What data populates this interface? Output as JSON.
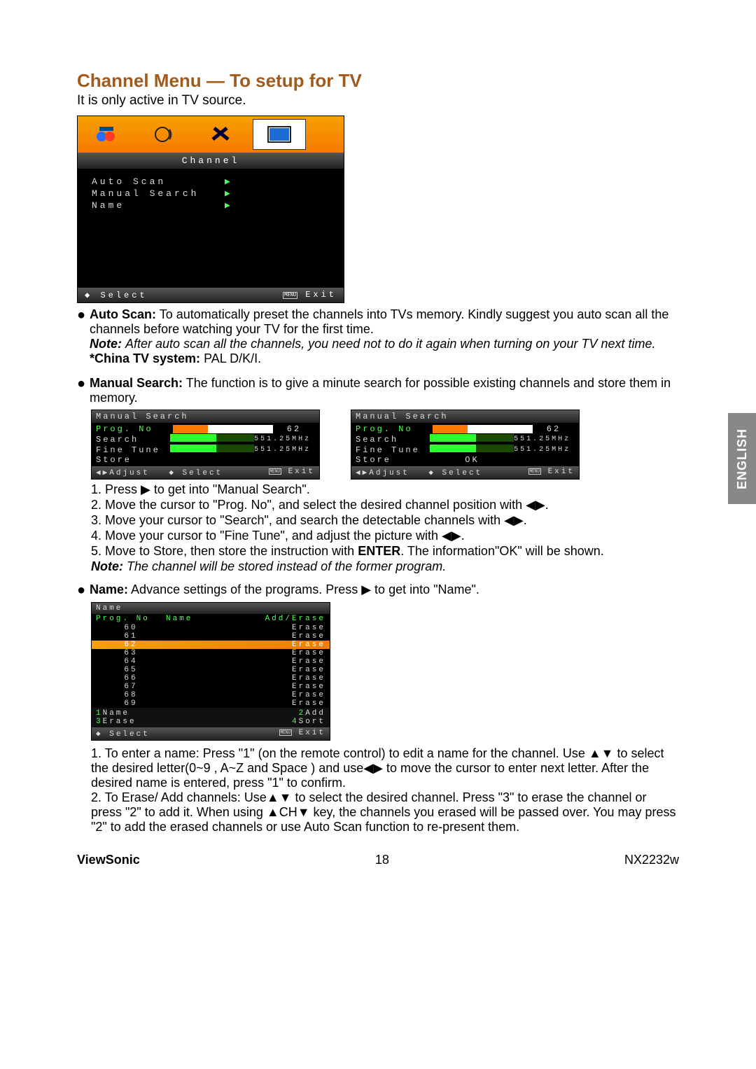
{
  "title": "Channel Menu — To setup for TV",
  "intro": "It is only active in TV source.",
  "osd": {
    "label": "Channel",
    "items": [
      "Auto Scan",
      "Manual Search",
      "Name"
    ],
    "foot_select_icon": "◆",
    "foot_select": "Select",
    "foot_menu": "MENU",
    "foot_exit": "Exit",
    "arrow": "▶"
  },
  "autoScan": {
    "label": "Auto Scan:",
    "text": "To automatically preset the channels into TVs memory. Kindly suggest you auto scan all the channels before watching your TV for the first time.",
    "note_label": "Note:",
    "note": "After auto scan all the channels, you need not to do it again when turning on your TV next time.",
    "china_label": "*China TV system:",
    "china_value": "PAL D/K/I."
  },
  "manualSearch": {
    "label": "Manual Search:",
    "text": "The function is to give a minute search for possible existing channels and store them in memory."
  },
  "ms_osd": {
    "title": "Manual Search",
    "progno": "Prog. No",
    "prognum": "62",
    "search": "Search",
    "finetune": "Fine Tune",
    "store": "Store",
    "ok": "OK",
    "freq": "551.25MHz",
    "foot_adjust": "◀▶Adjust",
    "foot_select": "◆ Select",
    "foot_menu": "MENU",
    "foot_exit": "Exit"
  },
  "ms_steps": {
    "s1": "1. Press ▶ to get into \"Manual Search\".",
    "s2": "2. Move the cursor to \"Prog. No\", and select the desired channel position with ◀▶.",
    "s3": "3. Move your cursor to \"Search\", and search the detectable channels with ◀▶.",
    "s4": "4. Move your cursor to \"Fine Tune\", and adjust the picture with ◀▶.",
    "s5_a": "5. Move to Store, then store the instruction with ",
    "s5_b": "ENTER",
    "s5_c": ". The information\"OK\" will be shown.",
    "note_label": "Note:",
    "note": "The channel will be stored instead of the former program."
  },
  "name": {
    "label": "Name:",
    "text": "Advance settings of the programs. Press ▶ to get into \"Name\"."
  },
  "name_osd": {
    "title": "Name",
    "h1": "Prog. No",
    "h2": "Name",
    "h3": "Add/Erase",
    "rows": [
      {
        "no": "60",
        "act": "Erase",
        "sel": false
      },
      {
        "no": "61",
        "act": "Erase",
        "sel": false
      },
      {
        "no": "62",
        "act": "Erase",
        "sel": true
      },
      {
        "no": "63",
        "act": "Erase",
        "sel": false
      },
      {
        "no": "64",
        "act": "Erase",
        "sel": false
      },
      {
        "no": "65",
        "act": "Erase",
        "sel": false
      },
      {
        "no": "66",
        "act": "Erase",
        "sel": false
      },
      {
        "no": "67",
        "act": "Erase",
        "sel": false
      },
      {
        "no": "68",
        "act": "Erase",
        "sel": false
      },
      {
        "no": "69",
        "act": "Erase",
        "sel": false
      }
    ],
    "k1": "1",
    "v1": "Name",
    "k2": "2",
    "v2": "Add",
    "k3": "3",
    "v3": "Erase",
    "k4": "4",
    "v4": "Sort",
    "foot_select": "◆ Select",
    "foot_menu": "MENU",
    "foot_exit": "Exit"
  },
  "name_instr": {
    "p1": "1. To enter a name: Press \"1\" (on the remote control) to edit a name for the channel. Use ▲▼ to select the desired letter(0~9 , A~Z and Space ) and use◀▶ to move the cursor to enter next letter. After the desired name is entered, press \"1\"  to confirm.",
    "p2": "2.  To Erase/ Add channels: Use▲▼ to select the desired channel. Press \"3\" to erase the channel or press \"2\" to add it. When using ▲CH▼ key, the channels you erased will be passed over. You may press \"2\"  to add the erased channels or use Auto Scan function to re-present them."
  },
  "footer": {
    "brand": "ViewSonic",
    "page": "18",
    "model": "NX2232w"
  },
  "lang_tab": "ENGLISH"
}
